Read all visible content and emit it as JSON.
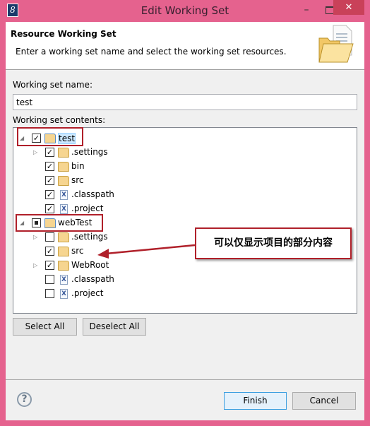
{
  "window": {
    "title": "Edit Working Set",
    "app_icon_glyph": "8"
  },
  "header": {
    "title": "Resource Working Set",
    "description": "Enter a working set name and select the working set resources."
  },
  "name_field": {
    "label": "Working set name:",
    "value": "test"
  },
  "contents": {
    "label": "Working set contents:",
    "items": [
      {
        "label": "test",
        "level": 0,
        "expander": "expanded",
        "state": "checked",
        "icon": "project-folder-icon",
        "selected": true
      },
      {
        "label": ".settings",
        "level": 1,
        "expander": "collapsed",
        "state": "checked",
        "icon": "folder-icon"
      },
      {
        "label": "bin",
        "level": 1,
        "expander": "none",
        "state": "checked",
        "icon": "folder-icon"
      },
      {
        "label": "src",
        "level": 1,
        "expander": "none",
        "state": "checked",
        "icon": "folder-icon"
      },
      {
        "label": ".classpath",
        "level": 1,
        "expander": "none",
        "state": "checked",
        "icon": "xml-file-icon"
      },
      {
        "label": ".project",
        "level": 1,
        "expander": "none",
        "state": "checked",
        "icon": "xml-file-icon"
      },
      {
        "label": "webTest",
        "level": 0,
        "expander": "expanded",
        "state": "partial",
        "icon": "web-project-icon"
      },
      {
        "label": ".settings",
        "level": 1,
        "expander": "collapsed",
        "state": "unchecked",
        "icon": "folder-icon"
      },
      {
        "label": "src",
        "level": 1,
        "expander": "none",
        "state": "checked",
        "icon": "folder-icon"
      },
      {
        "label": "WebRoot",
        "level": 1,
        "expander": "collapsed",
        "state": "checked",
        "icon": "folder-icon"
      },
      {
        "label": ".classpath",
        "level": 1,
        "expander": "none",
        "state": "unchecked",
        "icon": "xml-file-icon"
      },
      {
        "label": ".project",
        "level": 1,
        "expander": "none",
        "state": "unchecked",
        "icon": "xml-file-icon"
      }
    ]
  },
  "buttons": {
    "select_all": "Select All",
    "deselect_all": "Deselect All",
    "finish": "Finish",
    "cancel": "Cancel"
  },
  "annotation": {
    "text": "可以仅显示项目的部分内容",
    "color": "#b0202a"
  },
  "colors": {
    "window_frame": "#e5628e",
    "close_button": "#c94159"
  }
}
